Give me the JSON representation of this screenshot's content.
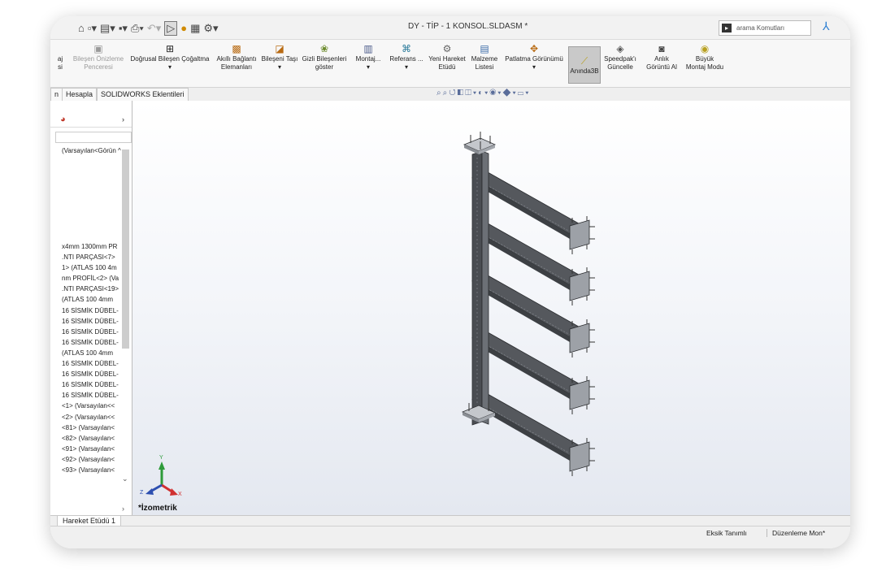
{
  "window": {
    "title": "DY - TİP - 1 KONSOL.SLDASM *"
  },
  "quick_access": {
    "icons": [
      "home-icon",
      "new-file-icon",
      "open-file-icon",
      "save-icon",
      "print-icon",
      "undo-icon",
      "select-icon",
      "rebuild-icon",
      "file-properties-icon",
      "options-icon"
    ]
  },
  "search": {
    "placeholder": "arama Komutları"
  },
  "ribbon": {
    "buttons": [
      {
        "label": "aj\nsi",
        "dim": false
      },
      {
        "label": "Bileşen Önizleme\nPenceresi",
        "dim": true
      },
      {
        "label": "Doğrusal Bileşen Çoğaltma\n▾",
        "dim": false
      },
      {
        "label": "Akıllı Bağlantı\nElemanları",
        "dim": false
      },
      {
        "label": "Bileşeni Taşı\n▾",
        "dim": false
      },
      {
        "label": "Gizli Bileşenleri\ngöster",
        "dim": false
      },
      {
        "label": "Montaj...\n▾",
        "dim": false
      },
      {
        "label": "Referans ...\n▾",
        "dim": false
      },
      {
        "label": "Yeni Hareket\nEtüdü",
        "dim": false
      },
      {
        "label": "Malzeme\nListesi",
        "dim": false
      },
      {
        "label": "Patlatma Görünümü\n▾",
        "dim": false
      },
      {
        "label": "Anında3B",
        "dim": false,
        "active": true
      },
      {
        "label": "Speedpak'ı\nGüncelle",
        "dim": false
      },
      {
        "label": "Anlık\nGörüntü Al",
        "dim": false
      },
      {
        "label": "Büyük\nMontaj Modu",
        "dim": false
      }
    ]
  },
  "tabs": [
    "n",
    "Hesapla",
    "SOLIDWORKS Eklentileri"
  ],
  "feature_tree": {
    "root": "(Varsayılan<Görün ^",
    "items": [
      "x4mm 1300mm PR",
      ".NTI PARÇASI<7>",
      "1> (ATLAS 100 4m",
      "nm PROFİL<2> (Va",
      ".NTI PARÇASI<19>",
      "(ATLAS 100 4mm",
      "16 SİSMİK DÜBEL-",
      "16 SİSMİK DÜBEL-",
      "16 SİSMİK DÜBEL-",
      "16 SİSMİK DÜBEL-",
      "(ATLAS 100 4mm",
      "16 SİSMİK DÜBEL-",
      "16 SİSMİK DÜBEL-",
      "16 SİSMİK DÜBEL-",
      "16 SİSMİK DÜBEL-",
      "<1> (Varsayılan<<",
      "<2> (Varsayılan<<",
      "<81> (Varsayılan<",
      "<82> (Varsayılan<",
      "<91> (Varsayılan<",
      "<92> (Varsayılan<",
      "<93> (Varsayılan<"
    ]
  },
  "viewport": {
    "view_name": "*İzometrik"
  },
  "bottom_tab": "Hareket Etüdü 1",
  "status": {
    "definition": "Eksik Tanımlı",
    "mode": "Düzenleme Mon*"
  }
}
